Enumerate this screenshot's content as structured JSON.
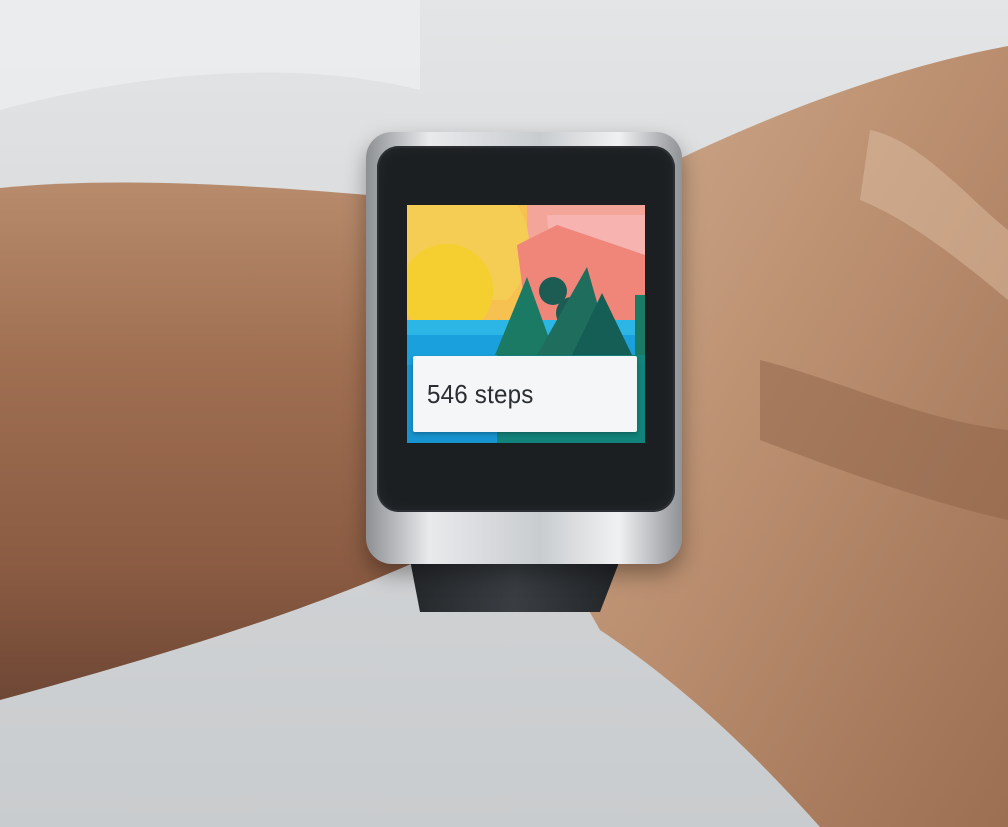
{
  "watch": {
    "card_text": "546 steps",
    "steps": 546
  },
  "colors": {
    "sky_pink": "#f3a59a",
    "sun_yellow": "#f5cf2f",
    "water_blue": "#1aa0dd",
    "tree_green": "#1b7a63",
    "card_background": "#f4f6f7"
  },
  "icons": [
    "landscape-wallpaper"
  ]
}
